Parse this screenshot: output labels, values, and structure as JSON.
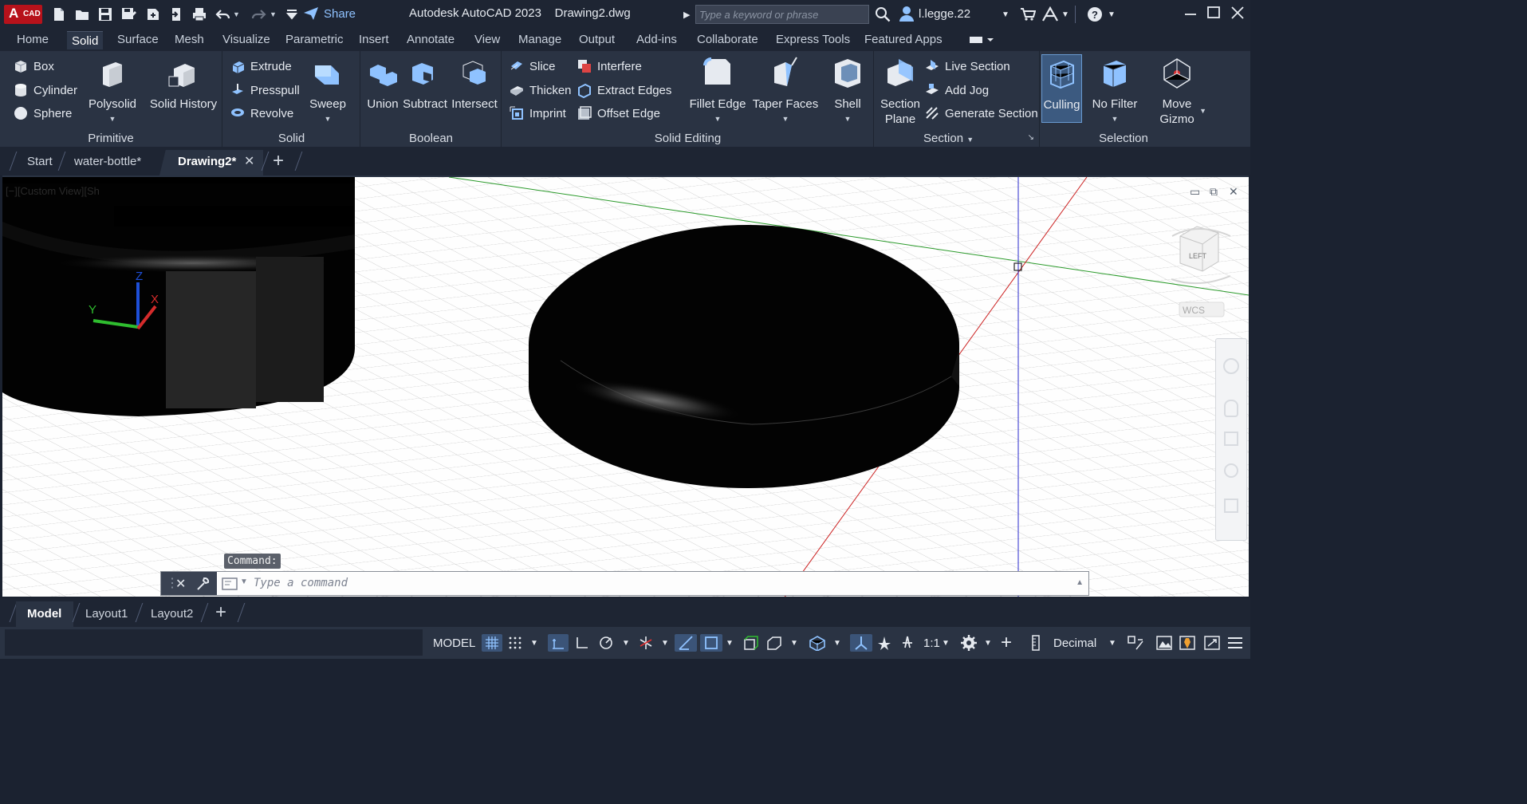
{
  "app": {
    "logo_main": "A",
    "logo_sub": "CAD",
    "title": "Autodesk AutoCAD 2023",
    "document": "Drawing2.dwg",
    "share_label": "Share",
    "search_placeholder": "Type a keyword or phrase",
    "username": "l.legge.22"
  },
  "menu_tabs": [
    "Home",
    "Solid",
    "Surface",
    "Mesh",
    "Visualize",
    "Parametric",
    "Insert",
    "Annotate",
    "View",
    "Manage",
    "Output",
    "Add-ins",
    "Collaborate",
    "Express Tools",
    "Featured Apps"
  ],
  "active_tab": "Solid",
  "ribbon": {
    "primitive": {
      "label": "Primitive",
      "box": "Box",
      "cylinder": "Cylinder",
      "sphere": "Sphere",
      "polysolid": "Polysolid",
      "solid_history": "Solid History"
    },
    "solid": {
      "label": "Solid",
      "extrude": "Extrude",
      "presspull": "Presspull",
      "revolve": "Revolve",
      "sweep": "Sweep"
    },
    "boolean": {
      "label": "Boolean",
      "union": "Union",
      "subtract": "Subtract",
      "intersect": "Intersect"
    },
    "solid_editing": {
      "label": "Solid Editing",
      "slice": "Slice",
      "thicken": "Thicken",
      "imprint": "Imprint",
      "interfere": "Interfere",
      "extract_edges": "Extract Edges",
      "offset_edge": "Offset Edge",
      "fillet_edge": "Fillet Edge",
      "taper_faces": "Taper Faces",
      "shell": "Shell"
    },
    "section": {
      "label": "Section",
      "section_plane_1": "Section",
      "section_plane_2": "Plane",
      "live_section": "Live Section",
      "add_jog": "Add Jog",
      "generate_section": "Generate Section"
    },
    "selection": {
      "label": "Selection",
      "culling": "Culling",
      "no_filter": "No Filter",
      "move_gizmo_1": "Move",
      "move_gizmo_2": "Gizmo"
    }
  },
  "file_tabs": {
    "start": "Start",
    "water_bottle": "water-bottle*",
    "drawing2": "Drawing2*"
  },
  "viewport": {
    "label": "[−][Custom View][Sh",
    "viewcube_face": "LEFT",
    "wcs": "WCS",
    "ucs_z": "Z",
    "ucs_y": "Y",
    "ucs_x": "X"
  },
  "command": {
    "hint": "Command:",
    "placeholder": "Type a command"
  },
  "layout_tabs": {
    "model": "Model",
    "layout1": "Layout1",
    "layout2": "Layout2"
  },
  "status": {
    "model": "MODEL",
    "scale": "1:1",
    "units": "Decimal"
  },
  "colors": {
    "accent": "#3b7ddd",
    "brand": "#b7121b",
    "bg": "#1e2533",
    "ribbon": "#2a3343"
  }
}
